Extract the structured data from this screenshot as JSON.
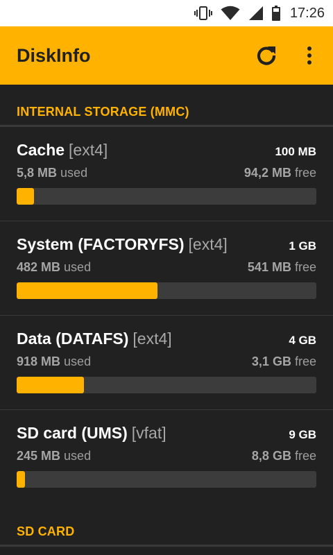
{
  "status_bar": {
    "time": "17:26",
    "icons": [
      "vibrate-icon",
      "wifi-icon",
      "cell-signal-icon",
      "battery-icon"
    ]
  },
  "app_bar": {
    "title": "DiskInfo",
    "actions": [
      "refresh-icon",
      "overflow-menu-icon"
    ]
  },
  "colors": {
    "accent": "#ffb300",
    "background": "#212121",
    "bar_track": "#3c3c3c"
  },
  "sections": [
    {
      "title": "INTERNAL STORAGE (MMC)",
      "partitions": [
        {
          "name": "Cache",
          "fs": "[ext4]",
          "total": "100 MB",
          "used_value": "5,8 MB",
          "used_suffix": "used",
          "free_value": "94,2 MB",
          "free_suffix": "free",
          "used_fraction": 0.058
        },
        {
          "name": "System (FACTORYFS)",
          "fs": "[ext4]",
          "total": "1 GB",
          "used_value": "482 MB",
          "used_suffix": "used",
          "free_value": "541 MB",
          "free_suffix": "free",
          "used_fraction": 0.471
        },
        {
          "name": "Data (DATAFS)",
          "fs": "[ext4]",
          "total": "4 GB",
          "used_value": "918 MB",
          "used_suffix": "used",
          "free_value": "3,1 GB",
          "free_suffix": "free",
          "used_fraction": 0.224
        },
        {
          "name": "SD card (UMS)",
          "fs": "[vfat]",
          "total": "9 GB",
          "used_value": "245 MB",
          "used_suffix": "used",
          "free_value": "8,8 GB",
          "free_suffix": "free",
          "used_fraction": 0.027
        }
      ]
    },
    {
      "title": "SD CARD",
      "partitions": []
    }
  ]
}
